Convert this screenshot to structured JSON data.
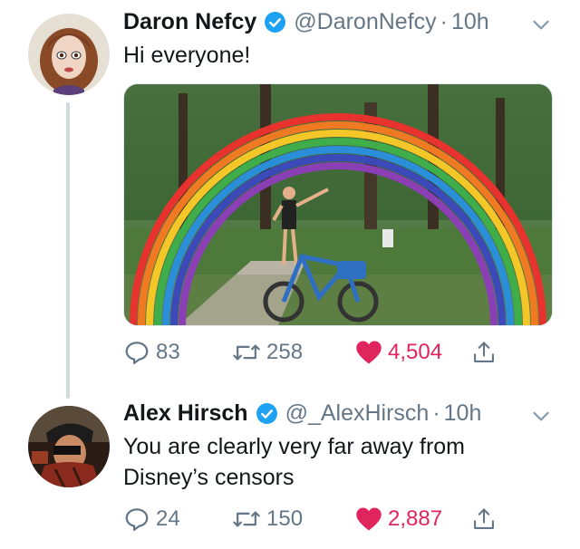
{
  "tweets": [
    {
      "name": "Daron Nefcy",
      "handle": "@DaronNefcy",
      "separator": "·",
      "time": "10h",
      "text": "Hi everyone!",
      "replies": "83",
      "retweets": "258",
      "likes": "4,504",
      "avatar_icon": "avatar-illustration-icon",
      "media": "rainbow-arch-photo"
    },
    {
      "name": "Alex Hirsch",
      "handle": "@_AlexHirsch",
      "separator": "·",
      "time": "10h",
      "text": "You are clearly very far away from Disney’s censors",
      "replies": "24",
      "retweets": "150",
      "likes": "2,887",
      "avatar_icon": "avatar-photo-icon"
    }
  ],
  "colors": {
    "verified": "#1da1f2",
    "like": "#e0245e",
    "muted": "#657786",
    "thread_line": "#cfd9de"
  },
  "icons": [
    "verified-badge-icon",
    "chevron-down-icon",
    "reply-icon",
    "retweet-icon",
    "heart-icon",
    "share-icon"
  ]
}
